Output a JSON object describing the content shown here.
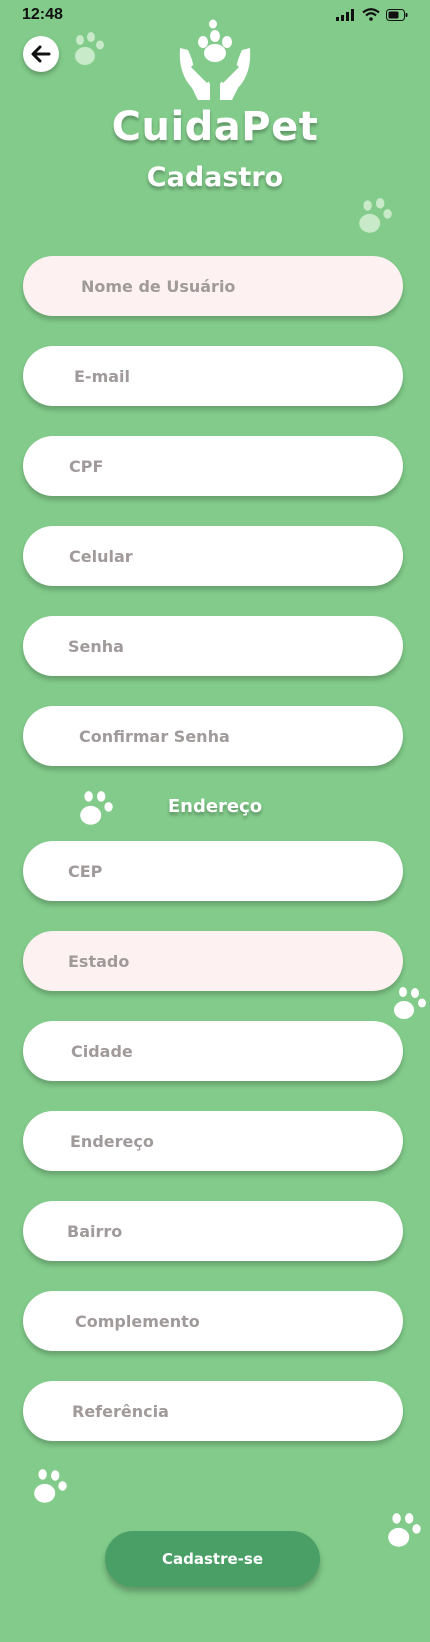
{
  "status_bar": {
    "time": "12:48"
  },
  "header": {
    "app_name": "CuidaPet",
    "page_title": "Cadastro"
  },
  "form": {
    "fields": [
      {
        "placeholder": "Nome de Usuário"
      },
      {
        "placeholder": "E-mail"
      },
      {
        "placeholder": "CPF"
      },
      {
        "placeholder": "Celular"
      },
      {
        "placeholder": "Senha"
      },
      {
        "placeholder": "Confirmar Senha"
      }
    ],
    "address_section_label": "Endereço",
    "address_fields": [
      {
        "placeholder": "CEP"
      },
      {
        "placeholder": "Estado"
      },
      {
        "placeholder": "Cidade"
      },
      {
        "placeholder": "Endereço"
      },
      {
        "placeholder": "Bairro"
      },
      {
        "placeholder": "Complemento"
      },
      {
        "placeholder": "Referência"
      }
    ],
    "submit_label": "Cadastre-se"
  },
  "colors": {
    "background": "#82cb8a",
    "button": "#4a9f66",
    "field": "#ffffff",
    "field_highlight": "#fdf1f1",
    "placeholder_text": "#a09a9a"
  },
  "icons": [
    "back-arrow-icon",
    "pet-care-hands-icon",
    "paw-print-icon",
    "signal-icon",
    "wifi-icon",
    "battery-icon"
  ]
}
